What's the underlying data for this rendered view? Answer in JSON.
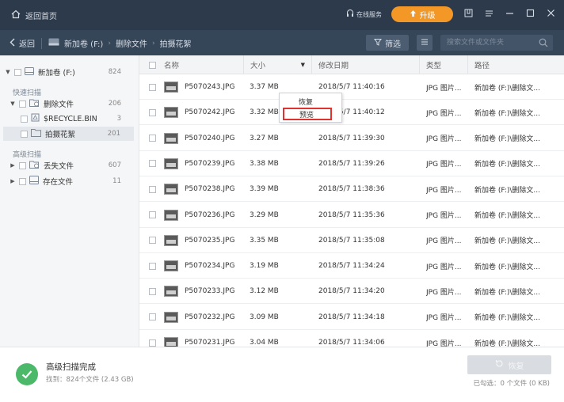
{
  "titlebar": {
    "home_label": "返回首页",
    "service_label": "在线服务",
    "upgrade_label": "升级"
  },
  "navbar": {
    "back_label": "返回",
    "breadcrumb": [
      "新加卷 (F:)",
      "删除文件",
      "拍摄花絮"
    ],
    "filter_label": "筛选",
    "search_placeholder": "搜索文件或文件夹"
  },
  "sidebar": {
    "root": {
      "label": "新加卷 (F:)",
      "count": "824"
    },
    "quick_scan_label": "快速扫描",
    "quick_items": [
      {
        "label": "删除文件",
        "count": "206"
      },
      {
        "label": "$RECYCLE.BIN",
        "count": "3"
      },
      {
        "label": "拍摄花絮",
        "count": "201"
      }
    ],
    "advanced_scan_label": "高级扫描",
    "advanced_items": [
      {
        "label": "丢失文件",
        "count": "607"
      },
      {
        "label": "存在文件",
        "count": "11"
      }
    ]
  },
  "table": {
    "headers": {
      "name": "名称",
      "size": "大小",
      "date": "修改日期",
      "type": "类型",
      "path": "路径"
    },
    "rows": [
      {
        "name": "P5070243.JPG",
        "size": "3.37 MB",
        "date": "2018/5/7 11:40:16",
        "type": "JPG 图片...",
        "path": "新加卷 (F:)\\删除文..."
      },
      {
        "name": "P5070242.JPG",
        "size": "3.32 MB",
        "date": "2018/5/7 11:40:12",
        "type": "JPG 图片...",
        "path": "新加卷 (F:)\\删除文..."
      },
      {
        "name": "P5070240.JPG",
        "size": "3.27 MB",
        "date": "2018/5/7 11:39:30",
        "type": "JPG 图片...",
        "path": "新加卷 (F:)\\删除文..."
      },
      {
        "name": "P5070239.JPG",
        "size": "3.38 MB",
        "date": "2018/5/7 11:39:26",
        "type": "JPG 图片...",
        "path": "新加卷 (F:)\\删除文..."
      },
      {
        "name": "P5070238.JPG",
        "size": "3.39 MB",
        "date": "2018/5/7 11:38:36",
        "type": "JPG 图片...",
        "path": "新加卷 (F:)\\删除文..."
      },
      {
        "name": "P5070236.JPG",
        "size": "3.29 MB",
        "date": "2018/5/7 11:35:36",
        "type": "JPG 图片...",
        "path": "新加卷 (F:)\\删除文..."
      },
      {
        "name": "P5070235.JPG",
        "size": "3.35 MB",
        "date": "2018/5/7 11:35:08",
        "type": "JPG 图片...",
        "path": "新加卷 (F:)\\删除文..."
      },
      {
        "name": "P5070234.JPG",
        "size": "3.19 MB",
        "date": "2018/5/7 11:34:24",
        "type": "JPG 图片...",
        "path": "新加卷 (F:)\\删除文..."
      },
      {
        "name": "P5070233.JPG",
        "size": "3.12 MB",
        "date": "2018/5/7 11:34:20",
        "type": "JPG 图片...",
        "path": "新加卷 (F:)\\删除文..."
      },
      {
        "name": "P5070232.JPG",
        "size": "3.09 MB",
        "date": "2018/5/7 11:34:18",
        "type": "JPG 图片...",
        "path": "新加卷 (F:)\\删除文..."
      },
      {
        "name": "P5070231.JPG",
        "size": "3.04 MB",
        "date": "2018/5/7 11:34:06",
        "type": "JPG 图片...",
        "path": "新加卷 (F:)\\删除文..."
      }
    ]
  },
  "context_menu": {
    "restore_label": "恢复",
    "preview_label": "预览"
  },
  "footer": {
    "status_title": "高级扫描完成",
    "status_detail": "找到：824个文件 (2.43 GB)",
    "recover_label": "恢复",
    "selected_info": "已勾选：0 个文件 (0 KB)"
  }
}
